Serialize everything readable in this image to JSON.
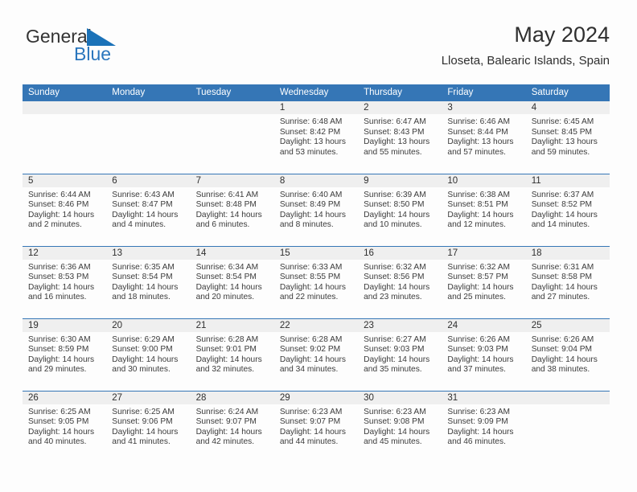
{
  "brand": {
    "name_part1": "General",
    "name_part2": "Blue",
    "accent_color": "#2a76bd",
    "logo_icon": "triangle-flag-icon"
  },
  "header": {
    "title": "May 2024",
    "subtitle": "Lloseta, Balearic Islands, Spain"
  },
  "calendar": {
    "header_bg": "#3576b6",
    "daynum_bg": "#efefef",
    "weekday_headers": [
      "Sunday",
      "Monday",
      "Tuesday",
      "Wednesday",
      "Thursday",
      "Friday",
      "Saturday"
    ],
    "weeks": [
      [
        {
          "day": "",
          "lines": []
        },
        {
          "day": "",
          "lines": []
        },
        {
          "day": "",
          "lines": []
        },
        {
          "day": "1",
          "lines": [
            "Sunrise: 6:48 AM",
            "Sunset: 8:42 PM",
            "Daylight: 13 hours",
            "and 53 minutes."
          ]
        },
        {
          "day": "2",
          "lines": [
            "Sunrise: 6:47 AM",
            "Sunset: 8:43 PM",
            "Daylight: 13 hours",
            "and 55 minutes."
          ]
        },
        {
          "day": "3",
          "lines": [
            "Sunrise: 6:46 AM",
            "Sunset: 8:44 PM",
            "Daylight: 13 hours",
            "and 57 minutes."
          ]
        },
        {
          "day": "4",
          "lines": [
            "Sunrise: 6:45 AM",
            "Sunset: 8:45 PM",
            "Daylight: 13 hours",
            "and 59 minutes."
          ]
        }
      ],
      [
        {
          "day": "5",
          "lines": [
            "Sunrise: 6:44 AM",
            "Sunset: 8:46 PM",
            "Daylight: 14 hours",
            "and 2 minutes."
          ]
        },
        {
          "day": "6",
          "lines": [
            "Sunrise: 6:43 AM",
            "Sunset: 8:47 PM",
            "Daylight: 14 hours",
            "and 4 minutes."
          ]
        },
        {
          "day": "7",
          "lines": [
            "Sunrise: 6:41 AM",
            "Sunset: 8:48 PM",
            "Daylight: 14 hours",
            "and 6 minutes."
          ]
        },
        {
          "day": "8",
          "lines": [
            "Sunrise: 6:40 AM",
            "Sunset: 8:49 PM",
            "Daylight: 14 hours",
            "and 8 minutes."
          ]
        },
        {
          "day": "9",
          "lines": [
            "Sunrise: 6:39 AM",
            "Sunset: 8:50 PM",
            "Daylight: 14 hours",
            "and 10 minutes."
          ]
        },
        {
          "day": "10",
          "lines": [
            "Sunrise: 6:38 AM",
            "Sunset: 8:51 PM",
            "Daylight: 14 hours",
            "and 12 minutes."
          ]
        },
        {
          "day": "11",
          "lines": [
            "Sunrise: 6:37 AM",
            "Sunset: 8:52 PM",
            "Daylight: 14 hours",
            "and 14 minutes."
          ]
        }
      ],
      [
        {
          "day": "12",
          "lines": [
            "Sunrise: 6:36 AM",
            "Sunset: 8:53 PM",
            "Daylight: 14 hours",
            "and 16 minutes."
          ]
        },
        {
          "day": "13",
          "lines": [
            "Sunrise: 6:35 AM",
            "Sunset: 8:54 PM",
            "Daylight: 14 hours",
            "and 18 minutes."
          ]
        },
        {
          "day": "14",
          "lines": [
            "Sunrise: 6:34 AM",
            "Sunset: 8:54 PM",
            "Daylight: 14 hours",
            "and 20 minutes."
          ]
        },
        {
          "day": "15",
          "lines": [
            "Sunrise: 6:33 AM",
            "Sunset: 8:55 PM",
            "Daylight: 14 hours",
            "and 22 minutes."
          ]
        },
        {
          "day": "16",
          "lines": [
            "Sunrise: 6:32 AM",
            "Sunset: 8:56 PM",
            "Daylight: 14 hours",
            "and 23 minutes."
          ]
        },
        {
          "day": "17",
          "lines": [
            "Sunrise: 6:32 AM",
            "Sunset: 8:57 PM",
            "Daylight: 14 hours",
            "and 25 minutes."
          ]
        },
        {
          "day": "18",
          "lines": [
            "Sunrise: 6:31 AM",
            "Sunset: 8:58 PM",
            "Daylight: 14 hours",
            "and 27 minutes."
          ]
        }
      ],
      [
        {
          "day": "19",
          "lines": [
            "Sunrise: 6:30 AM",
            "Sunset: 8:59 PM",
            "Daylight: 14 hours",
            "and 29 minutes."
          ]
        },
        {
          "day": "20",
          "lines": [
            "Sunrise: 6:29 AM",
            "Sunset: 9:00 PM",
            "Daylight: 14 hours",
            "and 30 minutes."
          ]
        },
        {
          "day": "21",
          "lines": [
            "Sunrise: 6:28 AM",
            "Sunset: 9:01 PM",
            "Daylight: 14 hours",
            "and 32 minutes."
          ]
        },
        {
          "day": "22",
          "lines": [
            "Sunrise: 6:28 AM",
            "Sunset: 9:02 PM",
            "Daylight: 14 hours",
            "and 34 minutes."
          ]
        },
        {
          "day": "23",
          "lines": [
            "Sunrise: 6:27 AM",
            "Sunset: 9:03 PM",
            "Daylight: 14 hours",
            "and 35 minutes."
          ]
        },
        {
          "day": "24",
          "lines": [
            "Sunrise: 6:26 AM",
            "Sunset: 9:03 PM",
            "Daylight: 14 hours",
            "and 37 minutes."
          ]
        },
        {
          "day": "25",
          "lines": [
            "Sunrise: 6:26 AM",
            "Sunset: 9:04 PM",
            "Daylight: 14 hours",
            "and 38 minutes."
          ]
        }
      ],
      [
        {
          "day": "26",
          "lines": [
            "Sunrise: 6:25 AM",
            "Sunset: 9:05 PM",
            "Daylight: 14 hours",
            "and 40 minutes."
          ]
        },
        {
          "day": "27",
          "lines": [
            "Sunrise: 6:25 AM",
            "Sunset: 9:06 PM",
            "Daylight: 14 hours",
            "and 41 minutes."
          ]
        },
        {
          "day": "28",
          "lines": [
            "Sunrise: 6:24 AM",
            "Sunset: 9:07 PM",
            "Daylight: 14 hours",
            "and 42 minutes."
          ]
        },
        {
          "day": "29",
          "lines": [
            "Sunrise: 6:23 AM",
            "Sunset: 9:07 PM",
            "Daylight: 14 hours",
            "and 44 minutes."
          ]
        },
        {
          "day": "30",
          "lines": [
            "Sunrise: 6:23 AM",
            "Sunset: 9:08 PM",
            "Daylight: 14 hours",
            "and 45 minutes."
          ]
        },
        {
          "day": "31",
          "lines": [
            "Sunrise: 6:23 AM",
            "Sunset: 9:09 PM",
            "Daylight: 14 hours",
            "and 46 minutes."
          ]
        },
        {
          "day": "",
          "lines": []
        }
      ]
    ]
  }
}
